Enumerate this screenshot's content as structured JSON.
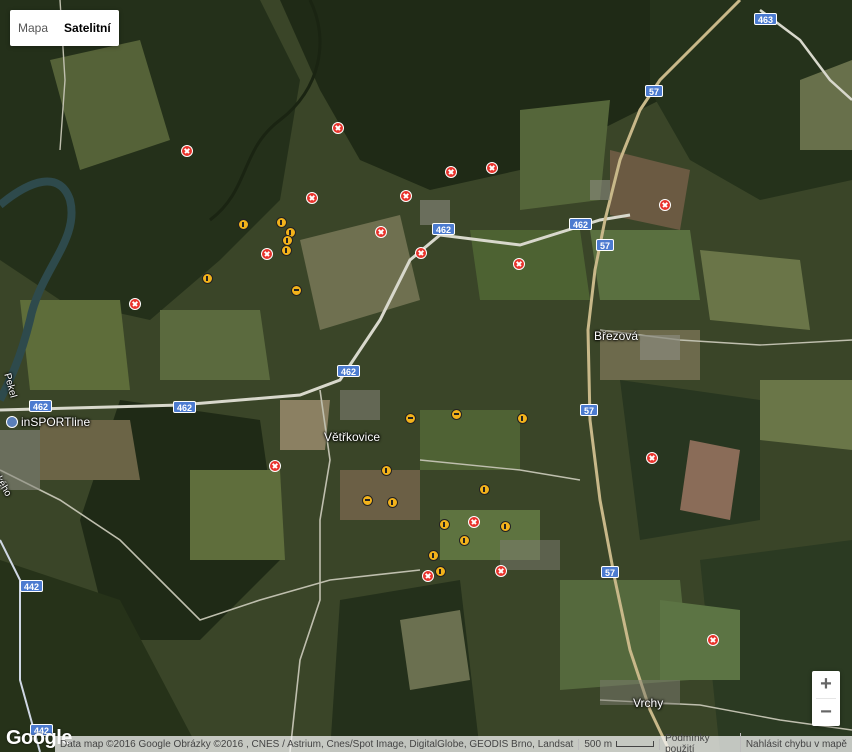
{
  "map_type": {
    "map_label": "Mapa",
    "satellite_label": "Satelitní",
    "active": "satellite"
  },
  "zoom": {
    "in_label": "+",
    "out_label": "−"
  },
  "road_shields": [
    {
      "id": "463",
      "label": "463"
    },
    {
      "id": "57a",
      "label": "57"
    },
    {
      "id": "462a",
      "label": "462"
    },
    {
      "id": "462b",
      "label": "462"
    },
    {
      "id": "57b",
      "label": "57"
    },
    {
      "id": "462c",
      "label": "462"
    },
    {
      "id": "462d",
      "label": "462"
    },
    {
      "id": "462e",
      "label": "462"
    },
    {
      "id": "57c",
      "label": "57"
    },
    {
      "id": "57d",
      "label": "57"
    },
    {
      "id": "442a",
      "label": "442"
    },
    {
      "id": "442b",
      "label": "442"
    }
  ],
  "places": [
    {
      "id": "brezova",
      "label": "Březová"
    },
    {
      "id": "vetrkovice",
      "label": "Větřkovice"
    },
    {
      "id": "vrchy",
      "label": "Vrchy"
    },
    {
      "id": "partial-left",
      "label": "ského"
    },
    {
      "id": "partial-left2",
      "label": "Pekel"
    }
  ],
  "poi": {
    "label": "inSPORTline",
    "icon": "shopping-icon"
  },
  "markers": {
    "red_count": 22,
    "yellow_count": 25,
    "red_icon": "closed-marker-icon",
    "yellow_icon": "info-marker-icon"
  },
  "footer": {
    "attribution": "Data map ©2016 Google Obrázky ©2016 , CNES / Astrium, Cnes/Spot Image, DigitalGlobe, GEODIS Brno, Landsat",
    "scale_label": "500 m",
    "terms_label": "Podmínky použití",
    "report_label": "Nahlásit chybu v mapě"
  },
  "logo_text": "Google",
  "colors": {
    "red_marker": "#e8332c",
    "yellow_marker": "#f2b21b",
    "shield": "#4c7bd0"
  }
}
